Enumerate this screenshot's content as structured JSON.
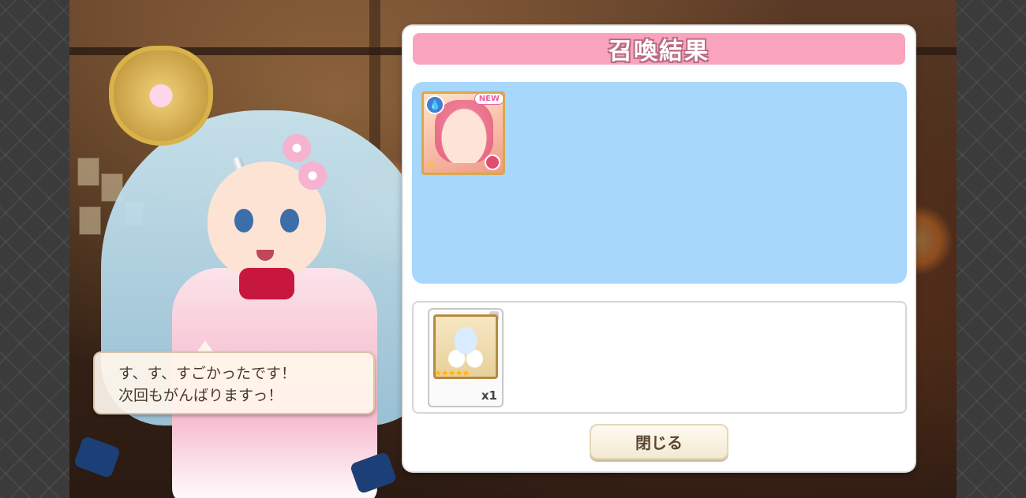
{
  "panel": {
    "title": "召喚結果",
    "summoned": [
      {
        "badge": "NEW",
        "attribute_icon": "water-drop-icon",
        "class_icon": "shield-icon"
      }
    ],
    "items": [
      {
        "quantity": "x1",
        "stars": "★★★★★"
      }
    ],
    "close_label": "閉じる"
  },
  "speech": {
    "line1": "す、す、すごかったです！",
    "line2": "次回もがんばりますっ！"
  },
  "colors": {
    "title_bar": "#f9a3bc",
    "character_area": "#a7d7fa",
    "close_button": "#f3ead3"
  }
}
